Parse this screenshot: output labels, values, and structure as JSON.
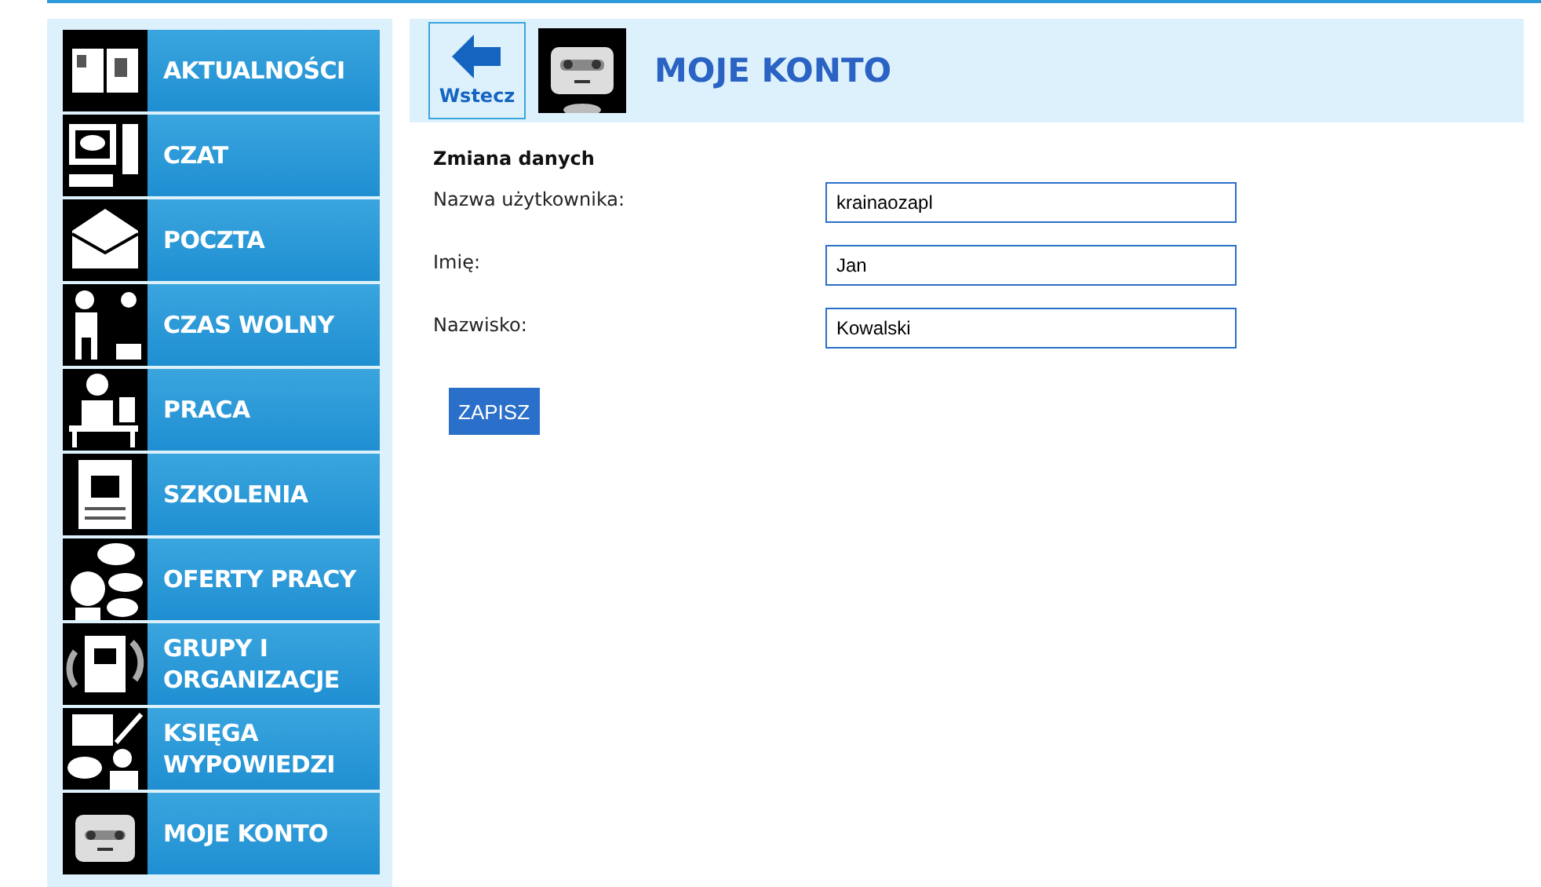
{
  "sidebar": {
    "items": [
      {
        "label": "AKTUALNOŚCI"
      },
      {
        "label": "CZAT"
      },
      {
        "label": "POCZTA"
      },
      {
        "label": "CZAS WOLNY"
      },
      {
        "label": "PRACA"
      },
      {
        "label": "SZKOLENIA"
      },
      {
        "label": "OFERTY PRACY"
      },
      {
        "label": "GRUPY I ORGANIZACJE"
      },
      {
        "label": "KSIĘGA WYPOWIEDZI"
      },
      {
        "label": "MOJE KONTO"
      }
    ]
  },
  "header": {
    "back_button": "Wstecz",
    "title": "MOJE KONTO"
  },
  "form": {
    "heading": "Zmiana danych",
    "fields": [
      {
        "label": "Nazwa użytkownika:",
        "value": "krainaozapl"
      },
      {
        "label": "Imię:",
        "value": "Jan"
      },
      {
        "label": "Nazwisko:",
        "value": "Kowalski"
      }
    ],
    "submit": "ZAPISZ"
  }
}
